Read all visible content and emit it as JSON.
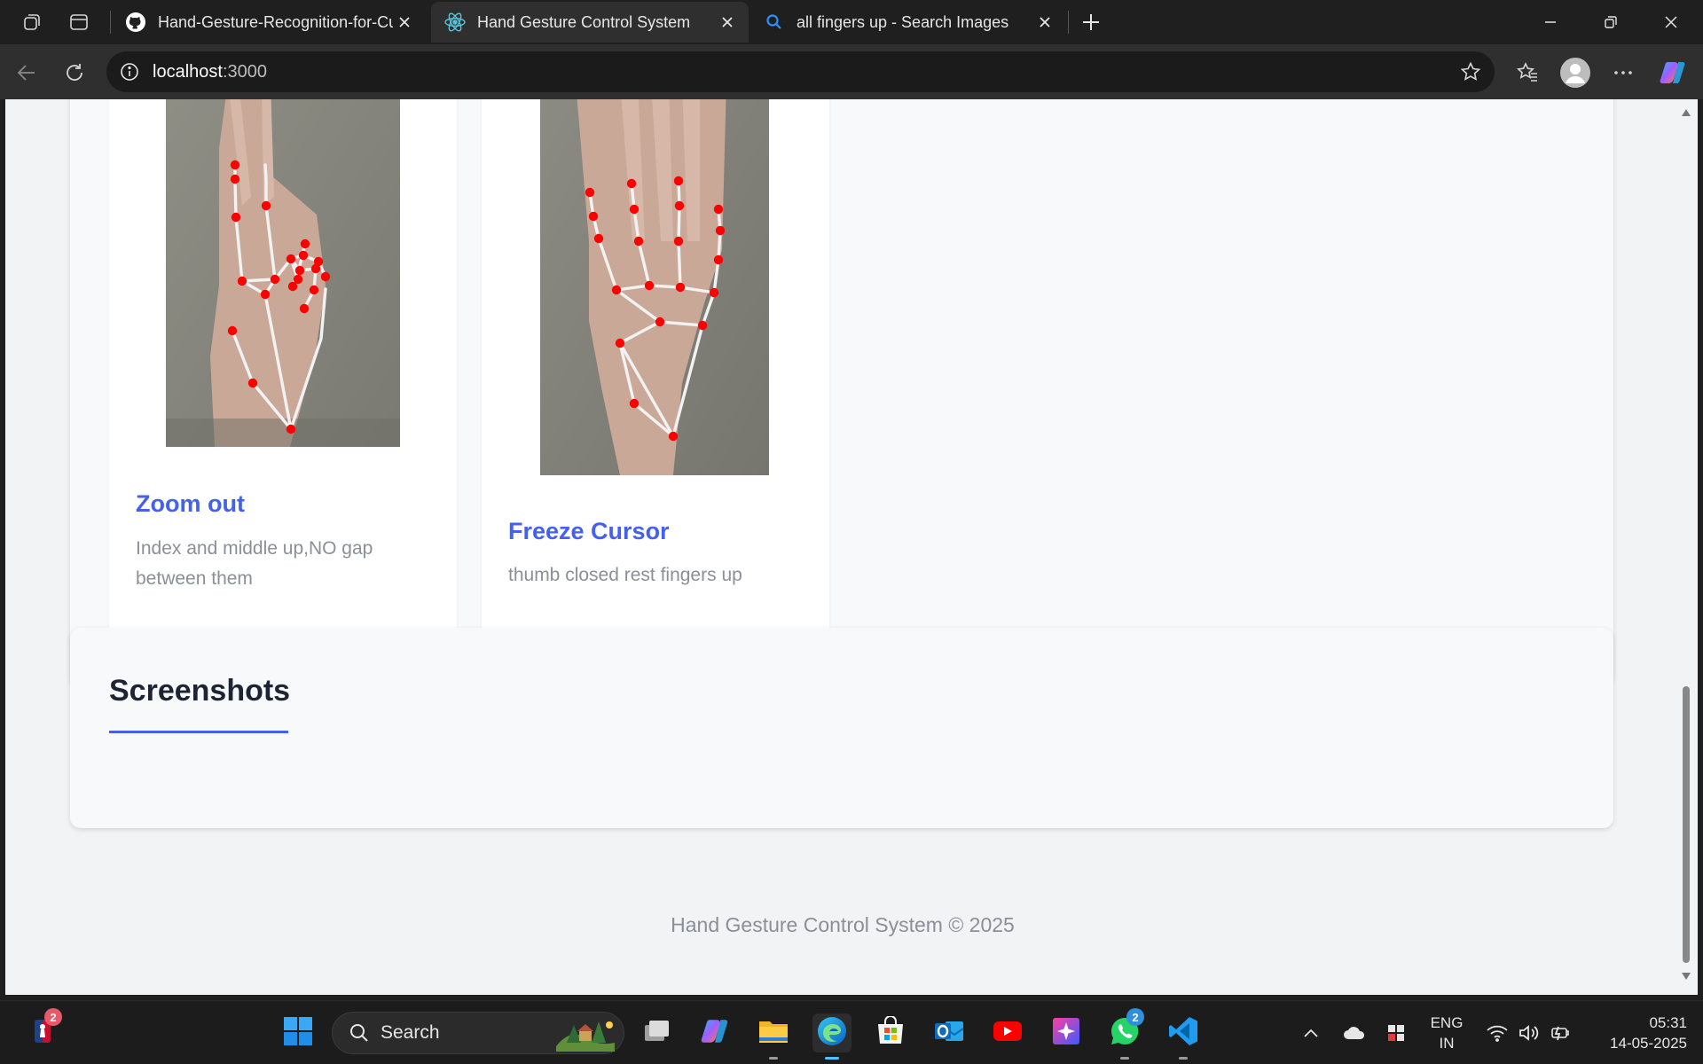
{
  "browser": {
    "tabs": [
      {
        "label": "Hand-Gesture-Recognition-for-Cursor-Control",
        "icon": "github-icon",
        "active": false
      },
      {
        "label": "Hand Gesture Control System",
        "icon": "react-icon",
        "active": true
      },
      {
        "label": "all fingers up - Search Images",
        "icon": "search-icon",
        "active": false
      }
    ],
    "address": {
      "host": "localhost",
      "port": ":3000"
    }
  },
  "page": {
    "gestures": [
      {
        "title": "Zoom out",
        "description": "Index and middle up,NO gap between them"
      },
      {
        "title": "Freeze Cursor",
        "description": "thumb closed rest fingers up"
      }
    ],
    "screenshots_heading": "Screenshots",
    "footer": "Hand Gesture Control System © 2025"
  },
  "taskbar": {
    "search_label": "Search",
    "widgets_badge": "2",
    "whatsapp_badge": "2",
    "apps": [
      "task-view",
      "copilot",
      "file-explorer",
      "edge",
      "microsoft-store",
      "outlook",
      "youtube",
      "perplexity",
      "whatsapp",
      "vscode"
    ],
    "tray": {
      "lang_line1": "ENG",
      "lang_line2": "IN",
      "time": "05:31",
      "date": "14-05-2025"
    }
  },
  "colors": {
    "accent": "#4361ee",
    "page_bg": "#f2f3f5",
    "card_bg": "#ffffff",
    "landmark": "#ff0000"
  }
}
